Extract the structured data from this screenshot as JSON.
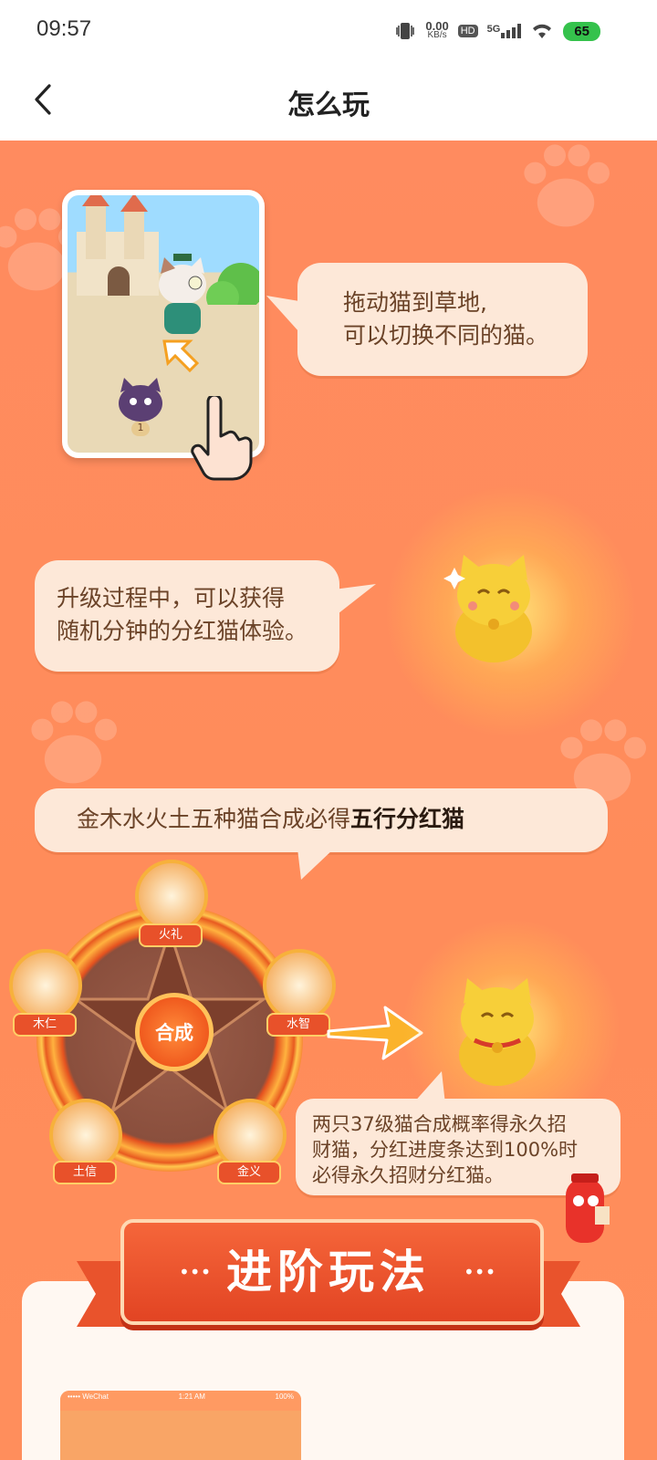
{
  "status_bar": {
    "time": "09:57",
    "net_speed_value": "0.00",
    "net_speed_unit": "KB/s",
    "hd": "HD",
    "signal": "5G",
    "battery": "65"
  },
  "header": {
    "title": "怎么玩"
  },
  "section1": {
    "bubble_line1": "拖动猫到草地,",
    "bubble_line2": "可以切换不同的猫。",
    "slot_label": "1"
  },
  "section2": {
    "bubble_line1": "升级过程中，可以获得",
    "bubble_line2": "随机分钟的分红猫体验。"
  },
  "section3": {
    "bubble_prefix": "金木水火土五种猫合成必得",
    "bubble_highlight": "五行分红猫",
    "center_label": "合成",
    "nodes": [
      "火礼",
      "水智",
      "金义",
      "土信",
      "木仁"
    ],
    "note_line1": "两只37级猫合成概率得永久招",
    "note_line2": "财猫，分红进度条达到100%时",
    "note_line3": "必得永久招财分红猫。"
  },
  "advanced": {
    "banner": "进阶玩法",
    "mini_status_left": "••••• WeChat",
    "mini_status_time": "1:21 AM",
    "mini_status_right": "100%"
  },
  "colors": {
    "background": "#ff8a5b",
    "bubble": "#fde8d8",
    "accent": "#e8512a"
  }
}
